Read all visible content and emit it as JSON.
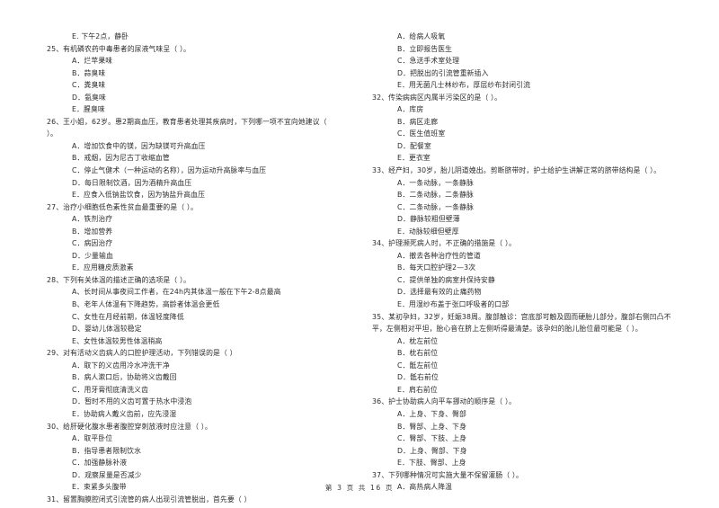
{
  "document": {
    "type": "exam-paper",
    "language": "zh-CN",
    "footer": "第 3 页 共 16 页"
  },
  "left_column": [
    {
      "kind": "option",
      "text": "E. 下午2点，静卧"
    },
    {
      "kind": "question",
      "number": "25",
      "stem": "25、有机磷农药中毒患者的尿液气味呈（      ）。",
      "options": [
        "A．烂苹果味",
        "B．蒜臭味",
        "C．粪臭味",
        "D．氨臭味",
        "E．腥臭味"
      ]
    },
    {
      "kind": "question",
      "number": "26",
      "stem": "26、王小姐，62岁。患2期高血压，教育患者处理其疾病时，下列哪一项不宜向她建议（",
      "stem_cont": "）。",
      "options": [
        "A．增加饮食中的镁，因为缺镁可升高血压",
        "B．戒烟，因为尼古丁收缩血管",
        "C．停止气健术（一种运动的名称），因为运动升高脉率与血压",
        "D．每日限制饮酒，因为酒精升高血压",
        "E．应食入低钠盐饮食，因为钠盐升高血压"
      ]
    },
    {
      "kind": "question",
      "number": "27",
      "stem": "27、治疗小细胞低色素性贫血最重要的是（      ）。",
      "options": [
        "A．铁剂治疗",
        "B．增加营养",
        "C．病因治疗",
        "D．少量输血",
        "E．应用糖皮质激素"
      ]
    },
    {
      "kind": "question",
      "number": "28",
      "stem": "28、下列有关体温的描述正确的选项是（      ）。",
      "options": [
        "A、长时间从事夜间工作者，在24h内其体温一般在下午2-8点最高",
        "B、老年人体温有下降趋势，高龄者体温会更低",
        "C、女性在月经前期，体温轻度降低",
        "D、婴幼儿体温较稳定",
        "E、女性体温较男性体温稍高"
      ]
    },
    {
      "kind": "question",
      "number": "29",
      "stem": "29、对有活动义齿病人的口腔护理活动，下列错误的是（      ）",
      "options": [
        "A．取下的义齿用冷水冲洗干净",
        "B．病人漱口后，协助将义齿戴回",
        "C．用牙膏彻底清洗义齿",
        "D．暂时不用的义齿可置于热水中浸泡",
        "E．协助病人戴义齿前，应先浸湿"
      ]
    },
    {
      "kind": "question",
      "number": "30",
      "stem": "30、给肝硬化腹水患者腹腔穿刺放液时应注意（      ）。",
      "options": [
        "A．取平卧位",
        "B．指导患者限制饮水",
        "C．加强静脉补液",
        "D．观察尿量是否减少",
        "E．束紧多头腹带"
      ]
    },
    {
      "kind": "question",
      "number": "31",
      "stem": "31、留置胸膜腔闭式引流管的病人出现引流管脱出，首先要（      ）",
      "options": []
    }
  ],
  "right_column": [
    {
      "kind": "options-continued",
      "options": [
        "A．给病人吸氧",
        "B．立即报告医生",
        "C．急送手术室处理",
        "D．把脱出的引流管重新插入",
        "E．用无菌凡士林纱布，厚层纱布封闭引流"
      ]
    },
    {
      "kind": "question",
      "number": "32",
      "stem": "32、传染病病区内属半污染区的是（      ）。",
      "options": [
        "A．库房",
        "B．病区走廊",
        "C．医生值班室",
        "D．配餐室",
        "E．更衣室"
      ]
    },
    {
      "kind": "question",
      "number": "33",
      "stem": "33、经产妇，30岁，胎儿阴道娩出。剪断脐带时，护士给护生讲解正常的脐带结构是（      ）。",
      "options": [
        "A．一条动脉，一条静脉",
        "B．二条动脉，二条静脉",
        "C．二条动脉，一条静脉",
        "D．静脉较粗但壁薄",
        "E．动脉较细但壁厚"
      ]
    },
    {
      "kind": "question",
      "number": "34",
      "stem": "34、护理濒死病人时，不正确的措施是（      ）。",
      "options": [
        "A．撤去各种治疗性的管道",
        "B．每天口腔护理2—3次",
        "C．提供单独的病室并保持安静",
        "D．选择最有效的止痛药物",
        "E．用湿纱布盖于张口呼吸者的口部"
      ]
    },
    {
      "kind": "question",
      "number": "35",
      "stem": "35、某初孕妇，32岁，妊娠38周。腹部触诊：宫底部可触及圆而硬胎儿部分，腹部右侧凹凸不",
      "stem_cont": "平，左侧相对平坦，胎心音在脐上左侧听得最清楚。该孕妇的胎儿胎位最可能是（      ）。",
      "options": [
        "A．枕左前位",
        "B．枕右前位",
        "C．骶左前位",
        "D．骶右前位",
        "E．肩右前位"
      ]
    },
    {
      "kind": "question",
      "number": "36",
      "stem": "36、护士协助病人向平车挪动的顺序是（      ）。",
      "options": [
        "A．上身、下身、臀部",
        "B．臀部、上身、下身",
        "C．臀部、下肢、上身",
        "D．上身、臀部、下身",
        "E．下肢、臀部、上身"
      ]
    },
    {
      "kind": "question",
      "number": "37",
      "stem": "37、下列哪种情况可实施大量不保留灌肠（      ）。",
      "options": [
        "A．高热病人降温"
      ]
    }
  ]
}
